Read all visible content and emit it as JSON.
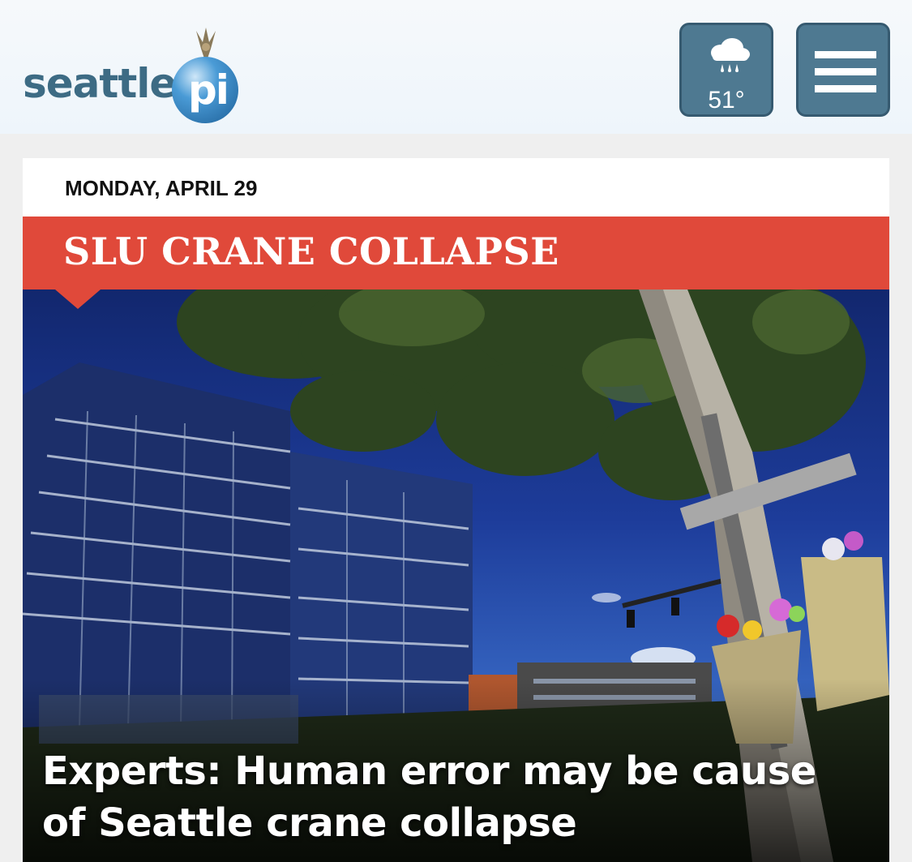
{
  "header": {
    "logo_text": "seattle",
    "logo_pi": "pi",
    "weather": {
      "icon": "rain-cloud-icon",
      "temperature": "51°"
    },
    "menu_icon": "hamburger-menu-icon"
  },
  "card": {
    "date": "MONDAY, APRIL 29",
    "section_banner": "SLU CRANE COLLAPSE",
    "headline": "Experts: Human error may be cause of Seattle crane collapse"
  },
  "colors": {
    "header_bg": "#eef5fb",
    "button_bg": "#4e7991",
    "banner_red": "#e0493a",
    "logo_blue": "#3d6b84"
  }
}
